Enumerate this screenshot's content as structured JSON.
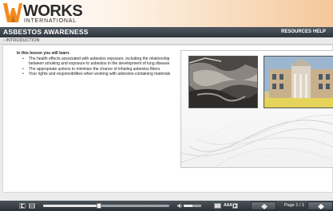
{
  "brand": {
    "name": "WORKS",
    "subtitle": "INTERNATIONAL",
    "accent": "#f28a1e"
  },
  "titlebar": {
    "title": "ASBESTOS AWARENESS",
    "links": [
      "RESOURCES",
      "HELP"
    ]
  },
  "breadcrumb": "› INTRODUCTION",
  "lesson": {
    "heading": "In this lesson you will learn:",
    "items": [
      "The health effects associated with asbestos exposure, including the relationship between smoking and exposure to asbestos in the development of lung disease",
      "The appropriate actions to minimize the chance of inhaling asbestos fibers",
      "Your rights and responsibilities when working with asbestos-containing materials"
    ]
  },
  "media": {
    "images": [
      "asbestos-material-photo",
      "school-building-photo"
    ]
  },
  "controls": {
    "progress": 0.44,
    "volume": 0.5,
    "text_size_label": "AAA",
    "page_label": "Page 1 / 1",
    "icons": [
      "rewind-icon",
      "pause-icon",
      "speaker-icon",
      "closed-caption-icon",
      "prev-arrow-icon",
      "next-arrow-icon"
    ]
  }
}
